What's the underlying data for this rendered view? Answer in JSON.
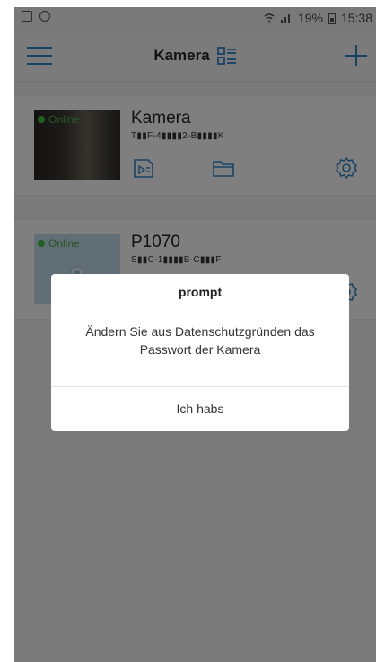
{
  "status_bar": {
    "battery_percent": "19%",
    "time": "15:38",
    "icons": [
      "gallery-icon",
      "alarm-icon",
      "wifi-icon",
      "signal-icon",
      "battery-icon"
    ]
  },
  "header": {
    "title": "Kamera",
    "icons": [
      "menu-icon",
      "list-view-icon",
      "plus-icon"
    ]
  },
  "cameras": [
    {
      "name": "Kamera",
      "status": "Online",
      "id": "T▮▮F-4▮▮▮▮2-B▮▮▮▮K"
    },
    {
      "name": "P1070",
      "status": "Online",
      "id": "S▮▮C-1▮▮▮▮B-C▮▮▮F"
    }
  ],
  "card_actions": [
    "playback-icon",
    "folder-icon",
    "settings-icon"
  ],
  "dialog": {
    "title": "prompt",
    "message": "Ändern Sie aus Datenschutzgründen das Passwort der Kamera",
    "button": "Ich habs"
  },
  "colors": {
    "accent": "#2d86c9",
    "online": "#3ec441",
    "overlay": "rgba(0,0,0,0.5)"
  }
}
